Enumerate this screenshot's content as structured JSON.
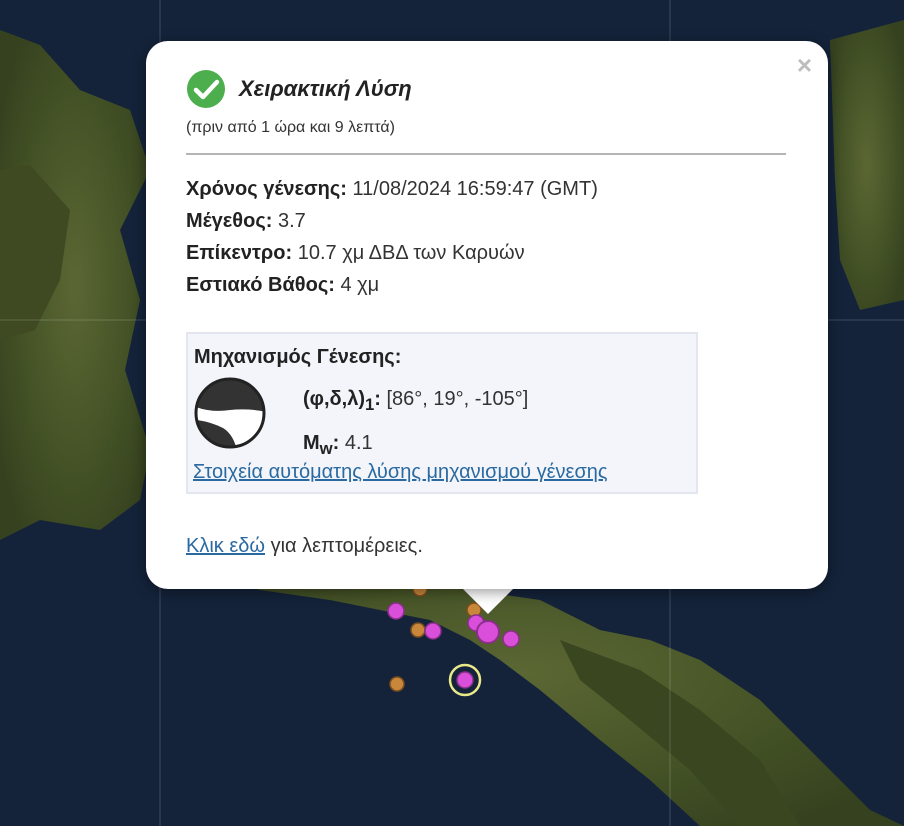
{
  "popup": {
    "close_label": "×",
    "status_icon": "check-circle-icon",
    "title": "Χειρακτική Λύση",
    "time_ago": "(πριν από 1 ώρα και 9 λεπτά)",
    "fields": {
      "origin_time_label": "Χρόνος γένεσης:",
      "origin_time_value": "11/08/2024 16:59:47 (GMT)",
      "magnitude_label": "Μέγεθος:",
      "magnitude_value": "3.7",
      "epicenter_label": "Επίκεντρο:",
      "epicenter_value": "10.7 χμ ΔΒΔ των Καρυών",
      "depth_label": "Εστιακό Βάθος:",
      "depth_value": "4 χμ"
    },
    "mechanism": {
      "title": "Μηχανισμός Γένεσης:",
      "beachball_icon": "beachball-icon",
      "params_label_main": "(φ,δ,λ)",
      "params_label_sub": "1",
      "params_label_colon": ":",
      "params_value": "[86°, 19°, -105°]",
      "mw_label_main": "M",
      "mw_label_sub": "w",
      "mw_label_colon": ":",
      "mw_value": "4.1",
      "link": "Στοιχεία αυτόματης λύσης μηχανισμού γένεσης"
    },
    "more_link": "Κλικ εδώ",
    "more_text": " για λεπτομέρειες."
  },
  "map": {
    "sea_color": "#14233a",
    "land_color": "#4e5a2e",
    "recent_marker_color": "#d94fd9",
    "older_marker_color": "#c8873a",
    "selected_ring_color": "#e8e98a"
  }
}
